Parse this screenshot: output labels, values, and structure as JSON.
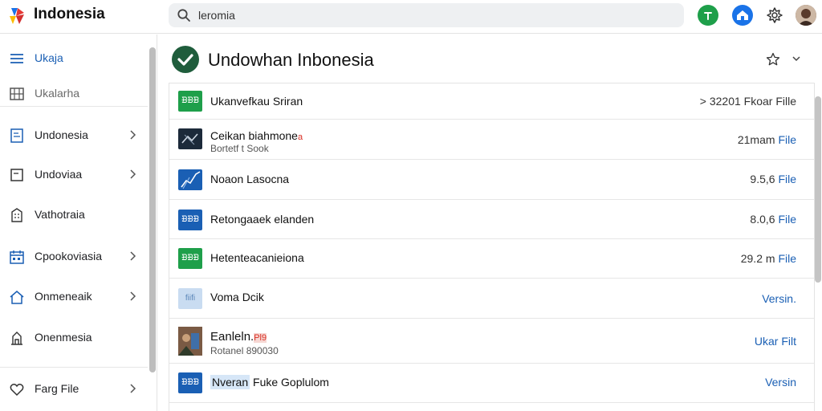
{
  "app": {
    "title": "Indonesia"
  },
  "search": {
    "value": "leromia"
  },
  "sidebar": {
    "items": [
      {
        "label": "Ukaja",
        "icon": "menu-icon"
      },
      {
        "label": "Ukalarha",
        "icon": "map-icon"
      },
      {
        "label": "Undonesia",
        "icon": "document-icon"
      },
      {
        "label": "Undoviaa",
        "icon": "square-icon"
      },
      {
        "label": "Vathotraia",
        "icon": "building-icon"
      },
      {
        "label": "Cpookoviasia",
        "icon": "calendar-icon"
      },
      {
        "label": "Onmeneaik",
        "icon": "home-icon"
      },
      {
        "label": "Onenmesia",
        "icon": "monument-icon"
      },
      {
        "label": "Farg File",
        "icon": "heart-icon"
      }
    ]
  },
  "main": {
    "title": "Undowhan Inbonesia",
    "rows": [
      {
        "thumb": "ᗿᗿᗿ",
        "name": "Ukanvefkau Sriran",
        "meta": "> 32201 Fkoar Fille",
        "link": ""
      },
      {
        "thumb": "",
        "name": "Ceikan biahmone",
        "subtag": "a",
        "sub": "Bortetf t Sook",
        "meta": "21mam ",
        "link": "File"
      },
      {
        "thumb": "",
        "name": "Noaon Lasocna",
        "meta": "9.5,6 ",
        "link": "File"
      },
      {
        "thumb": "ᗿᗿᗿ",
        "name": "Retongaaek elanden",
        "meta": "8.0,6 ",
        "link": "File"
      },
      {
        "thumb": "ᗿᗿᗿ",
        "name": "Hetenteacanieiona",
        "meta": "29.2 m ",
        "link": "File"
      },
      {
        "thumb": "fiifi",
        "name": "Voma Dcik",
        "meta": "",
        "link": "Versin."
      },
      {
        "thumb": "",
        "name": "Eanleln.",
        "subtag": "Pl9",
        "sub": "Rotanel 890030",
        "meta": "",
        "link": "Ukar Filt"
      },
      {
        "thumb": "ᗿᗿᗿ",
        "highlight": "Nveran",
        "name": "Fuke Goplulom",
        "meta": "",
        "link": "Versin"
      }
    ]
  },
  "colors": {
    "accent": "#1a5fb4",
    "green": "#1e9f4a",
    "check": "#1f5d3c"
  }
}
